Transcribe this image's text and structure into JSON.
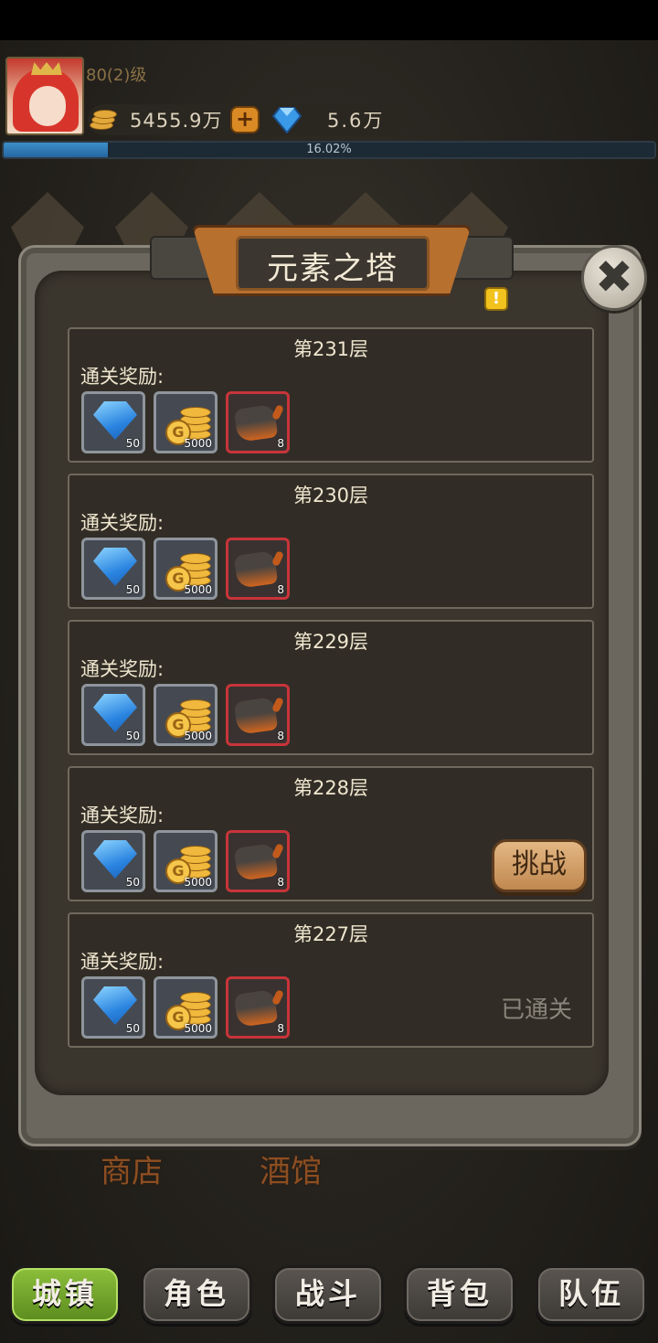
{
  "player": {
    "level": "80(2)级",
    "gold": "5455.9万",
    "gems": "5.6万",
    "progress_text": "16.02%",
    "progress_fraction": 0.1602
  },
  "dialog": {
    "title": "元素之塔",
    "reward_label": "通关奖励:",
    "floors": [
      {
        "name": "第231层",
        "rewards": [
          {
            "icon": "blue-gem-icon",
            "qty": "50"
          },
          {
            "icon": "gold-coin-stack-icon",
            "qty": "5000"
          },
          {
            "icon": "fire-ore-icon",
            "qty": "8"
          }
        ]
      },
      {
        "name": "第230层",
        "rewards": [
          {
            "icon": "blue-gem-icon",
            "qty": "50"
          },
          {
            "icon": "gold-coin-stack-icon",
            "qty": "5000"
          },
          {
            "icon": "fire-ore-icon",
            "qty": "8"
          }
        ]
      },
      {
        "name": "第229层",
        "rewards": [
          {
            "icon": "blue-gem-icon",
            "qty": "50"
          },
          {
            "icon": "gold-coin-stack-icon",
            "qty": "5000"
          },
          {
            "icon": "fire-ore-icon",
            "qty": "8"
          }
        ]
      },
      {
        "name": "第228层",
        "rewards": [
          {
            "icon": "blue-gem-icon",
            "qty": "50"
          },
          {
            "icon": "gold-coin-stack-icon",
            "qty": "5000"
          },
          {
            "icon": "fire-ore-icon",
            "qty": "8"
          }
        ],
        "action": "挑战"
      },
      {
        "name": "第227层",
        "rewards": [
          {
            "icon": "blue-gem-icon",
            "qty": "50"
          },
          {
            "icon": "gold-coin-stack-icon",
            "qty": "5000"
          },
          {
            "icon": "fire-ore-icon",
            "qty": "8"
          }
        ],
        "status": "已通关"
      }
    ]
  },
  "background_labels": [
    "商店",
    "酒馆"
  ],
  "nav": [
    "城镇",
    "角色",
    "战斗",
    "背包",
    "队伍"
  ],
  "colors": {
    "accent_green": "#8dbf3c",
    "rare_red": "#c8343a",
    "progress_blue": "#3d8fc9"
  }
}
